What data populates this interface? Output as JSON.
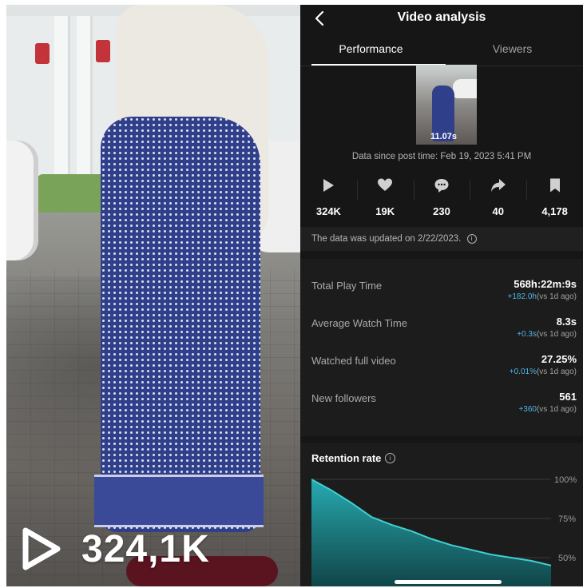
{
  "video": {
    "play_count": "324,1K"
  },
  "header": {
    "title": "Video analysis"
  },
  "tabs": [
    {
      "label": "Performance",
      "active": true
    },
    {
      "label": "Viewers",
      "active": false
    }
  ],
  "thumbnail": {
    "duration": "11.07s"
  },
  "data_since": "Data since post time: Feb 19, 2023 5:41 PM",
  "stats": [
    {
      "icon": "play-icon",
      "value": "324K"
    },
    {
      "icon": "heart-icon",
      "value": "19K"
    },
    {
      "icon": "comment-icon",
      "value": "230"
    },
    {
      "icon": "share-icon",
      "value": "40"
    },
    {
      "icon": "bookmark-icon",
      "value": "4,178"
    }
  ],
  "updated_note": "The data was updated on 2/22/2023.",
  "metrics": [
    {
      "label": "Total Play Time",
      "value": "568h:22m:9s",
      "delta": "+182.0h",
      "compare": "(vs 1d ago)"
    },
    {
      "label": "Average Watch Time",
      "value": "8.3s",
      "delta": "+0.3s",
      "compare": "(vs 1d ago)"
    },
    {
      "label": "Watched full video",
      "value": "27.25%",
      "delta": "+0.01%",
      "compare": "(vs 1d ago)"
    },
    {
      "label": "New followers",
      "value": "561",
      "delta": "+360",
      "compare": "(vs 1d ago)"
    }
  ],
  "retention": {
    "title": "Retention rate",
    "ticks": [
      "100%",
      "75%",
      "50%"
    ],
    "accent": "#27b3b8",
    "curve": [
      100,
      93,
      85,
      76,
      71,
      67,
      62,
      58,
      55,
      52,
      50,
      48,
      45
    ]
  }
}
